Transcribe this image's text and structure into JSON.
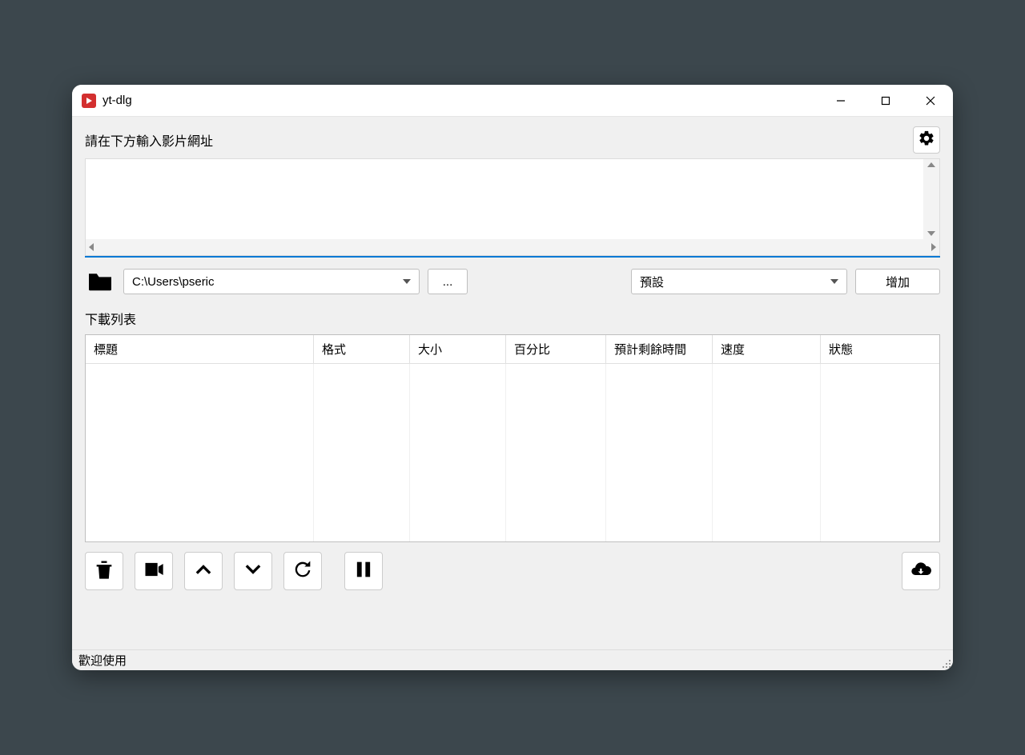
{
  "window": {
    "title": "yt-dlg"
  },
  "url_section": {
    "label": "請在下方輸入影片網址",
    "value": ""
  },
  "path_row": {
    "path": "C:\\Users\\pseric",
    "browse_label": "...",
    "preset": "預設",
    "add_label": "增加"
  },
  "download_list": {
    "label": "下載列表",
    "columns": {
      "title": "標題",
      "format": "格式",
      "size": "大小",
      "percent": "百分比",
      "eta": "預計剩餘時間",
      "speed": "速度",
      "status": "狀態"
    }
  },
  "statusbar": {
    "text": "歡迎使用"
  }
}
